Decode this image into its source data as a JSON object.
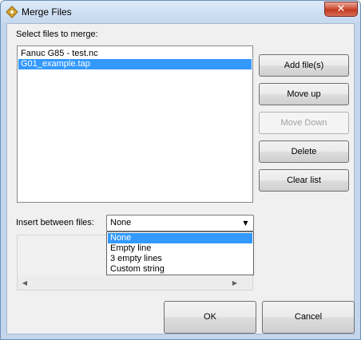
{
  "window": {
    "title": "Merge Files",
    "close_symbol": "✕",
    "app_icon": "merge-files-app-icon",
    "close_icon": "close-icon"
  },
  "files": {
    "label": "Select files to merge:",
    "items": [
      {
        "name": "Fanuc G85 - test.nc",
        "selected": false
      },
      {
        "name": "G01_example.tap",
        "selected": true
      }
    ]
  },
  "buttons": {
    "add_files": "Add file(s)",
    "move_up": "Move up",
    "move_down": "Move Down",
    "delete": "Delete",
    "clear_list": "Clear list",
    "ok": "OK",
    "cancel": "Cancel"
  },
  "insert_between": {
    "label": "Insert between files:",
    "value": "None",
    "arrow_icon": "dropdown-arrow-icon",
    "options": [
      "None",
      "Empty line",
      "3 empty lines",
      "Custom string"
    ],
    "selected_index": 0
  },
  "preview": {
    "scroll_left_icon": "scroll-left-icon",
    "scroll_right_icon": "scroll-right-icon",
    "left_glyph": "◀",
    "right_glyph": "▶"
  },
  "colors": {
    "selection": "#3399ff",
    "title_bar": "#c5d8ef",
    "close_button": "#c03a20"
  }
}
